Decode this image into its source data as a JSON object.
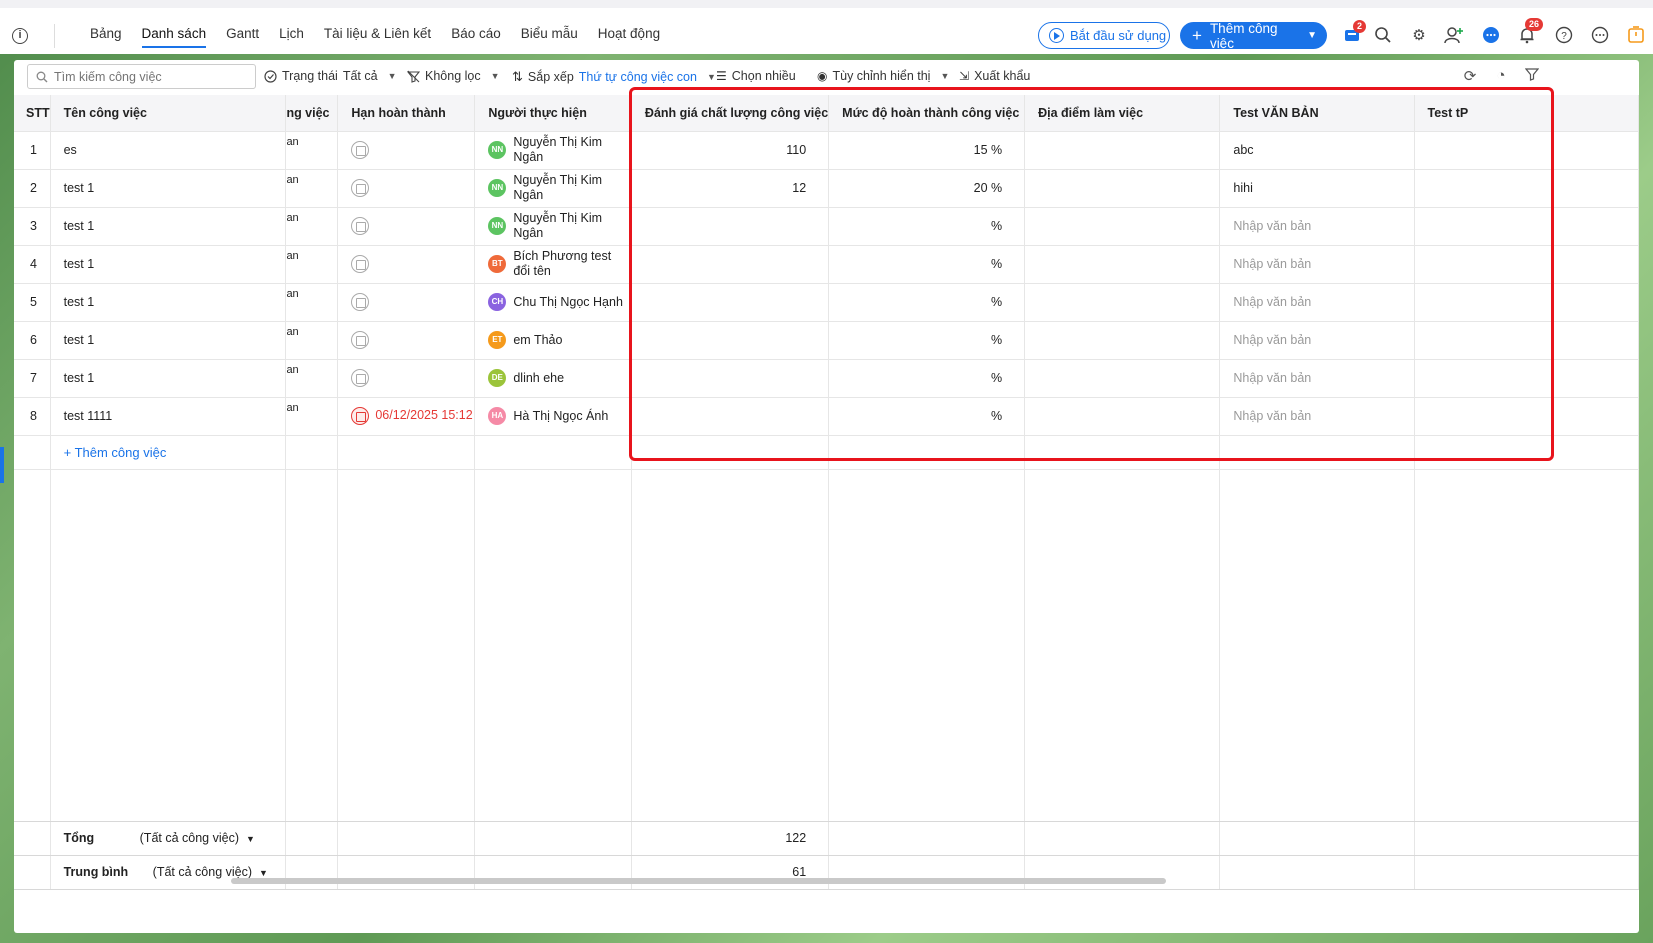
{
  "nav": {
    "tabs": [
      {
        "label": "Bảng"
      },
      {
        "label": "Danh sách"
      },
      {
        "label": "Gantt"
      },
      {
        "label": "Lịch"
      },
      {
        "label": "Tài liệu & Liên kết"
      },
      {
        "label": "Báo cáo"
      },
      {
        "label": "Biểu mẫu"
      },
      {
        "label": "Hoạt động"
      }
    ],
    "start_label": "Bắt đầu sử dụng",
    "add_label": "Thêm công việc",
    "cart_badge": "2",
    "bell_badge": "26"
  },
  "toolbar": {
    "search_placeholder": "Tìm kiếm công việc",
    "status_label": "Trạng thái",
    "status_value": "Tất cả",
    "filter_label": "Không lọc",
    "sort_label": "Sắp xếp",
    "sort_value": "Thứ tự công việc con",
    "multi_label": "Chọn nhiều",
    "display_label": "Tùy chỉnh hiển thị",
    "export_label": "Xuất khẩu"
  },
  "table": {
    "headers": {
      "stt": "STT",
      "name": "Tên công việc",
      "clipped": "ng việc",
      "due": "Hạn hoàn thành",
      "assignee": "Người thực hiện",
      "quality": "Đánh giá chất lượng công việc",
      "completion": "Mức độ hoàn thành công việc",
      "location": "Địa điểm làm việc",
      "text": "Test VĂN BẢN",
      "tp": "Test tP"
    },
    "rows": [
      {
        "stt": "1",
        "name": "es",
        "clip": "an",
        "due": "",
        "assignee": "Nguyễn Thị Kim Ngân",
        "initials": "NN",
        "color": "#5cc461",
        "quality": "110",
        "completion": "15 %",
        "text": "abc"
      },
      {
        "stt": "2",
        "name": "test 1",
        "clip": "an",
        "due": "",
        "assignee": "Nguyễn Thị Kim Ngân",
        "initials": "NN",
        "color": "#5cc461",
        "quality": "12",
        "completion": "20 %",
        "text": "hihi"
      },
      {
        "stt": "3",
        "name": "test 1",
        "clip": "an",
        "due": "",
        "assignee": "Nguyễn Thị Kim Ngân",
        "initials": "NN",
        "color": "#5cc461",
        "quality": "",
        "completion": "%",
        "text": "Nhập văn bản"
      },
      {
        "stt": "4",
        "name": "test 1",
        "clip": "an",
        "due": "",
        "assignee": "Bích Phương test đổi tên",
        "initials": "BT",
        "color": "#ef6a3a",
        "quality": "",
        "completion": "%",
        "text": "Nhập văn bản"
      },
      {
        "stt": "5",
        "name": "test 1",
        "clip": "an",
        "due": "",
        "assignee": "Chu Thị Ngọc Hạnh",
        "initials": "CH",
        "color": "#8a63e0",
        "quality": "",
        "completion": "%",
        "text": "Nhập văn bản"
      },
      {
        "stt": "6",
        "name": "test 1",
        "clip": "an",
        "due": "",
        "assignee": "em Thảo",
        "initials": "ET",
        "color": "#f59a1b",
        "quality": "",
        "completion": "%",
        "text": "Nhập văn bản"
      },
      {
        "stt": "7",
        "name": "test 1",
        "clip": "an",
        "due": "",
        "assignee": "dlinh ehe",
        "initials": "DE",
        "color": "#9bc43a",
        "quality": "",
        "completion": "%",
        "text": "Nhập văn bản"
      },
      {
        "stt": "8",
        "name": "test 1111",
        "clip": "an",
        "due": "06/12/2025 15:12",
        "assignee": "Hà Thị Ngọc Ánh",
        "initials": "HA",
        "color": "#f58aa6",
        "quality": "",
        "completion": "%",
        "text": "Nhập văn bản"
      }
    ],
    "add_task": "+ Thêm công việc",
    "footer": {
      "total_label": "Tổng",
      "avg_label": "Trung bình",
      "scope": "(Tất cả công việc)",
      "total_quality": "122",
      "avg_quality": "61"
    }
  },
  "colors": {
    "accent": "#1a73e8",
    "highlight": "#e8141c",
    "overdue": "#e53935"
  }
}
